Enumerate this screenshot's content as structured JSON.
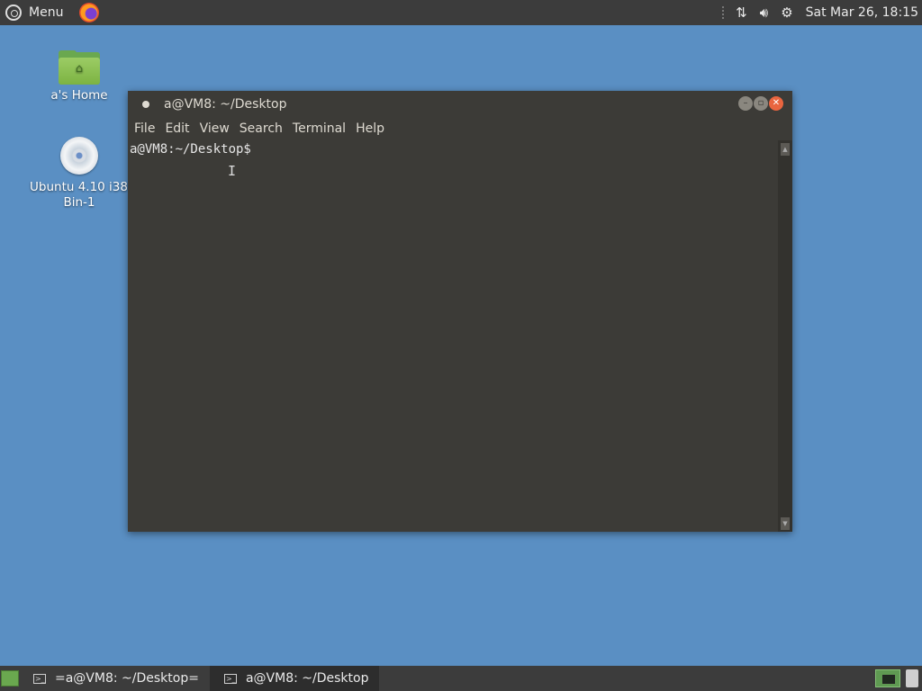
{
  "top_panel": {
    "menu_label": "Menu",
    "clock": "Sat Mar 26, 18:15"
  },
  "desktop": {
    "icons": [
      {
        "label": "a's Home"
      },
      {
        "label_line1": "Ubuntu 4.10 i386",
        "label_line2": "Bin-1"
      }
    ]
  },
  "terminal": {
    "title": "a@VM8: ~/Desktop",
    "menu": [
      "File",
      "Edit",
      "View",
      "Search",
      "Terminal",
      "Help"
    ],
    "prompt": "a@VM8:~/Desktop$"
  },
  "taskbar": {
    "tasks": [
      {
        "label": "=a@VM8: ~/Desktop="
      },
      {
        "label": "a@VM8: ~/Desktop"
      }
    ]
  },
  "icons": {
    "menu": "ubuntu-logo-icon",
    "browser": "firefox-icon",
    "network": "network-updown-icon",
    "volume": "volume-icon",
    "settings": "gear-icon",
    "home_folder": "home-folder-icon",
    "cdrom": "cd-disc-icon",
    "terminal_task": "terminal-icon",
    "show_desktop": "show-desktop-icon",
    "workspace": "workspace-switcher-icon",
    "trash": "trash-icon"
  },
  "colors": {
    "desktop_bg": "#5a8fc3",
    "panel_bg": "#3c3c3c",
    "terminal_bg": "#3c3b37",
    "close_button": "#e9653f"
  }
}
